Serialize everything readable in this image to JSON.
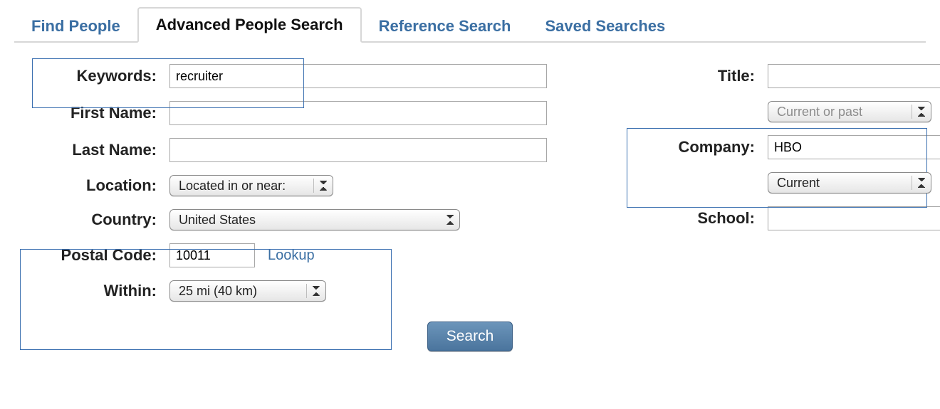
{
  "tabs": {
    "find_people": "Find People",
    "advanced": "Advanced People Search",
    "reference": "Reference Search",
    "saved": "Saved Searches"
  },
  "left": {
    "keywords_label": "Keywords:",
    "keywords_value": "recruiter",
    "first_name_label": "First Name:",
    "first_name_value": "",
    "last_name_label": "Last Name:",
    "last_name_value": "",
    "location_label": "Location:",
    "location_value": "Located in or near:",
    "country_label": "Country:",
    "country_value": "United States",
    "postal_label": "Postal Code:",
    "postal_value": "10011",
    "lookup_label": "Lookup",
    "within_label": "Within:",
    "within_value": "25 mi (40 km)"
  },
  "right": {
    "title_label": "Title:",
    "title_value": "",
    "title_scope": "Current or past",
    "company_label": "Company:",
    "company_value": "HBO",
    "company_scope": "Current",
    "school_label": "School:",
    "school_value": ""
  },
  "search_button": "Search"
}
